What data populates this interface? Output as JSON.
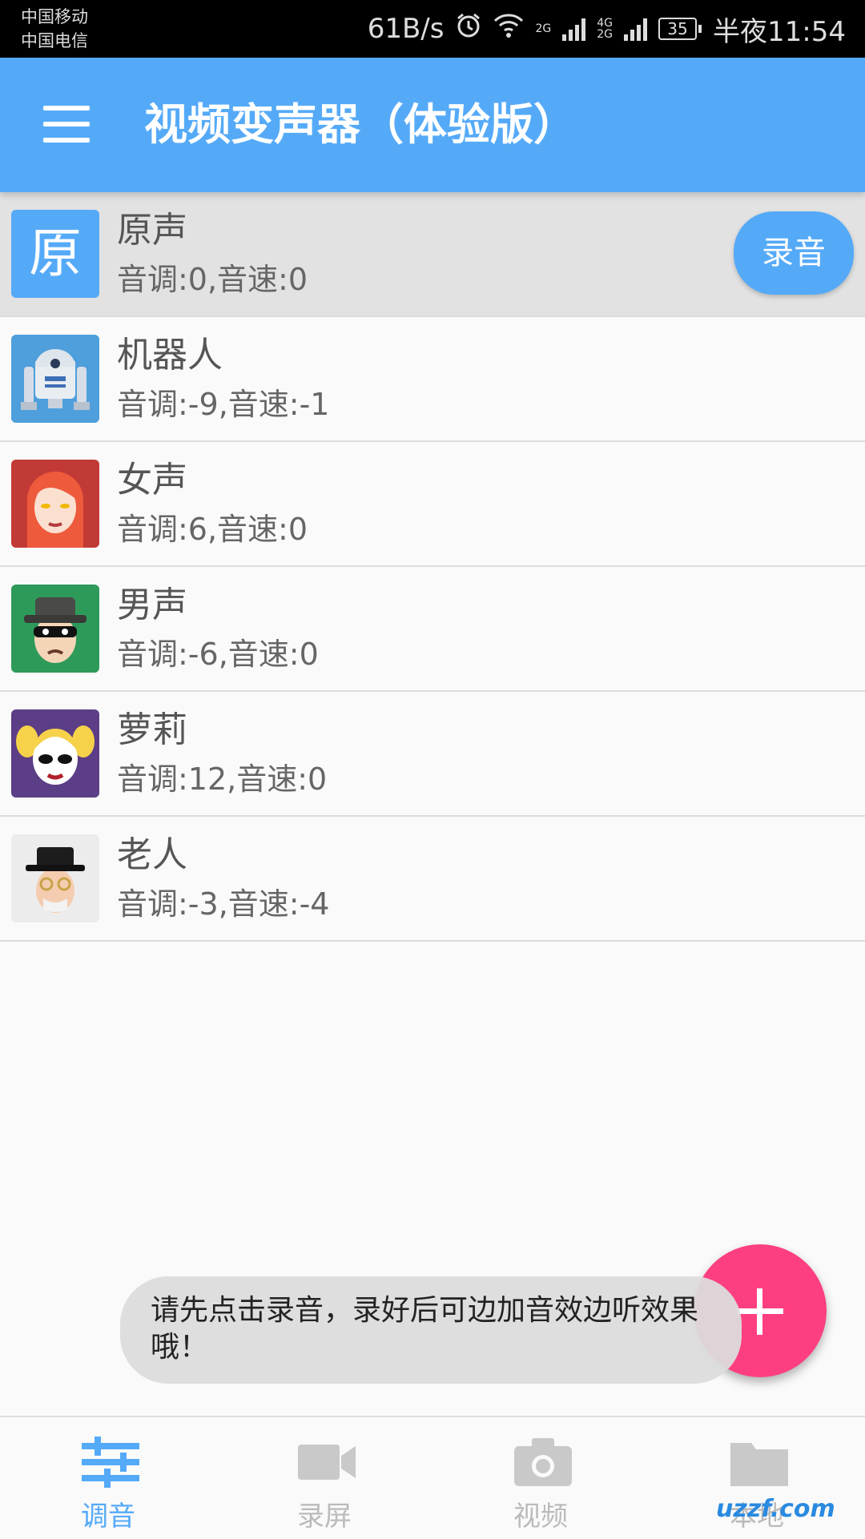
{
  "status_bar": {
    "carrier_1": "中国移动",
    "carrier_2": "中国电信",
    "net_speed": "61B/s",
    "sim1_type": "2G",
    "sim2_type": "4G\n2G",
    "battery": "35",
    "time": "半夜11:54"
  },
  "app_bar": {
    "title": "视频变声器（体验版）",
    "menu_icon": "hamburger-menu-icon"
  },
  "voices": [
    {
      "avatar_text": "原",
      "name": "原声",
      "params": "音调:0,音速:0",
      "icon": "original-voice-icon",
      "selected": true
    },
    {
      "name": "机器人",
      "params": "音调:-9,音速:-1",
      "icon": "robot-icon"
    },
    {
      "name": "女声",
      "params": "音调:6,音速:0",
      "icon": "female-icon"
    },
    {
      "name": "男声",
      "params": "音调:-6,音速:0",
      "icon": "male-masked-icon"
    },
    {
      "name": "萝莉",
      "params": "音调:12,音速:0",
      "icon": "loli-icon"
    },
    {
      "name": "老人",
      "params": "音调:-3,音速:-4",
      "icon": "old-man-icon"
    }
  ],
  "record_button": "录音",
  "fab_icon": "plus-icon",
  "toast": "请先点击录音，录好后可边加音效边听效果哦！",
  "bottom_nav": [
    {
      "label": "调音",
      "icon": "sliders-icon",
      "active": true
    },
    {
      "label": "录屏",
      "icon": "video-camera-icon"
    },
    {
      "label": "视频",
      "icon": "camera-icon"
    },
    {
      "label": "本地",
      "icon": "folder-icon"
    }
  ],
  "watermark": "uzzf.com",
  "colors": {
    "primary": "#55aaf8",
    "accent": "#fd3f82",
    "selected_row": "#e2e2e2"
  }
}
